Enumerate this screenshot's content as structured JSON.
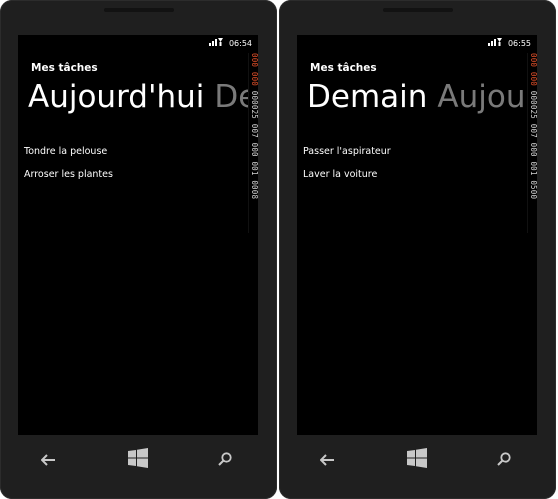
{
  "phones": [
    {
      "status": {
        "time": "06:54"
      },
      "app_title": "Mes tâches",
      "pivot": {
        "active": "Aujourd'hui",
        "next_peek": "De"
      },
      "tasks": [
        "Tondre la pelouse",
        "Arroser les plantes"
      ],
      "debug_counters": {
        "hot": "000 000",
        "rest": "000025 007 000 001 0008"
      }
    },
    {
      "status": {
        "time": "06:55"
      },
      "app_title": "Mes tâches",
      "pivot": {
        "active": "Demain",
        "next_peek": "Aujou"
      },
      "tasks": [
        "Passer l'aspirateur",
        "Laver la voiture"
      ],
      "debug_counters": {
        "hot": "000 000",
        "rest": "000025 007 000 001 0500"
      }
    }
  ],
  "icons": {
    "signal": "signal-icon",
    "back": "back-arrow-icon",
    "start": "windows-logo-icon",
    "search": "search-icon"
  },
  "colors": {
    "screen_bg": "#000000",
    "bezel": "#1f1f1f",
    "inactive_header": "#7a7a7a",
    "counter_hot": "#e0502a"
  }
}
